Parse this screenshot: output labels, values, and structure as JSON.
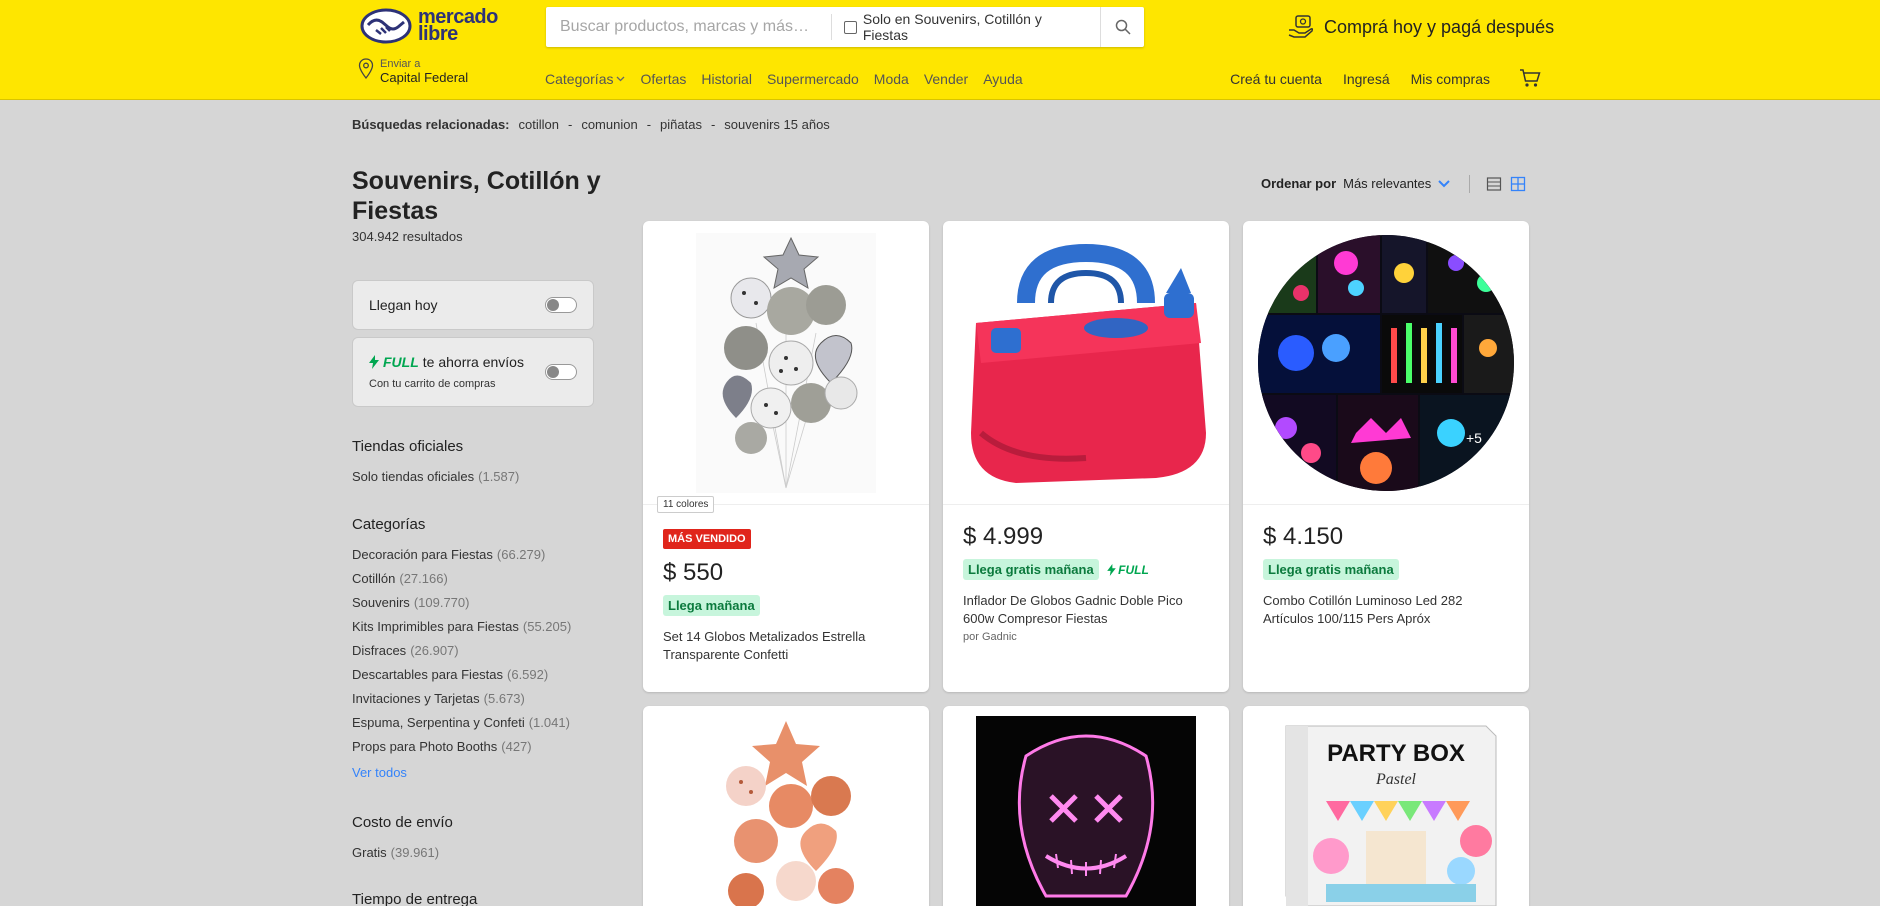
{
  "header": {
    "logo_line1": "mercado",
    "logo_line2": "libre",
    "search_placeholder": "Buscar productos, marcas y más…",
    "search_filter_label": "Solo en Souvenirs, Cotillón y Fiestas",
    "promo_text": "Comprá hoy y pagá después",
    "location_small": "Enviar a",
    "location_big": "Capital Federal",
    "nav": [
      "Categorías",
      "Ofertas",
      "Historial",
      "Supermercado",
      "Moda",
      "Vender",
      "Ayuda"
    ],
    "account": [
      "Creá tu cuenta",
      "Ingresá",
      "Mis compras"
    ]
  },
  "related": {
    "label": "Búsquedas relacionadas:",
    "terms": [
      "cotillon",
      "comunion",
      "piñatas",
      "souvenirs 15 años"
    ],
    "separator": "-"
  },
  "sidebar": {
    "title": "Souvenirs, Cotillón y Fiestas",
    "count": "304.942 resultados",
    "filter_today": "Llegan hoy",
    "full_brand": "FULL",
    "full_text": "te ahorra envíos",
    "full_sub": "Con tu carrito de compras",
    "official_heading": "Tiendas oficiales",
    "official_item": "Solo tiendas oficiales",
    "official_count": "(1.587)",
    "categories_heading": "Categorías",
    "categories": [
      {
        "label": "Decoración para Fiestas",
        "count": "(66.279)"
      },
      {
        "label": "Cotillón",
        "count": "(27.166)"
      },
      {
        "label": "Souvenirs",
        "count": "(109.770)"
      },
      {
        "label": "Kits Imprimibles para Fiestas",
        "count": "(55.205)"
      },
      {
        "label": "Disfraces",
        "count": "(26.907)"
      },
      {
        "label": "Descartables para Fiestas",
        "count": "(6.592)"
      },
      {
        "label": "Invitaciones y Tarjetas",
        "count": "(5.673)"
      },
      {
        "label": "Espuma, Serpentina y Confeti",
        "count": "(1.041)"
      },
      {
        "label": "Props para Photo Booths",
        "count": "(427)"
      }
    ],
    "see_all": "Ver todos",
    "shipping_heading": "Costo de envío",
    "shipping_item": "Gratis",
    "shipping_count": "(39.961)",
    "delivery_heading": "Tiempo de entrega"
  },
  "sort": {
    "label": "Ordenar por",
    "value": "Más relevantes"
  },
  "products": [
    {
      "colors": "11 colores",
      "badge": "MÁS VENDIDO",
      "price": "$ 550",
      "shipping": "Llega mañana",
      "title": "Set 14 Globos Metalizados Estrella Transparente Confetti"
    },
    {
      "price": "$ 4.999",
      "shipping": "Llega gratis mañana",
      "full": "FULL",
      "title": "Inflador De Globos Gadnic Doble Pico 600w Compresor Fiestas",
      "by": "por Gadnic"
    },
    {
      "price": "$ 4.150",
      "shipping": "Llega gratis mañana",
      "title": "Combo Cotillón Luminoso Led 282 Artículos 100/115 Pers Apróx",
      "more": "+5"
    },
    {
      "image_text": "PARTY BOX",
      "image_subtext": "Pastel"
    }
  ],
  "colors": {
    "brand_yellow": "#fee600",
    "accent_blue": "#3483fa",
    "ship_green": "#00a650",
    "best_red": "#e0251b"
  }
}
